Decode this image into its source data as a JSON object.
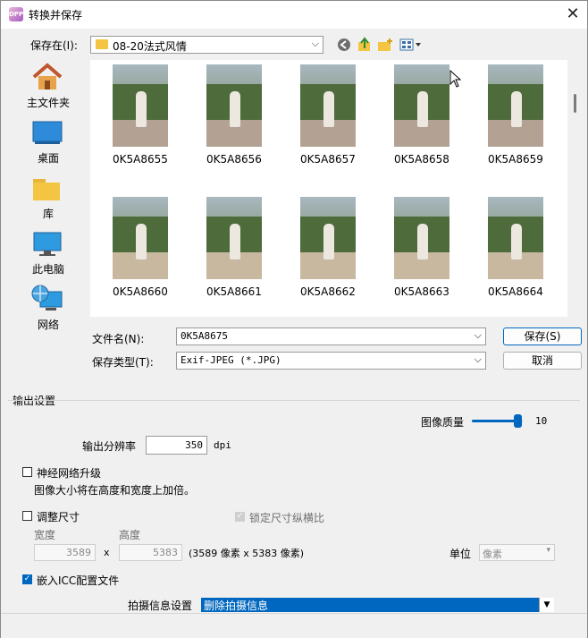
{
  "window": {
    "title": "转换并保存",
    "app_icon": "DPP",
    "close": "✕"
  },
  "save_in": {
    "label": "保存在(I):",
    "folder": "08-20法式风情"
  },
  "toolbar_icons": [
    "back-icon",
    "up-folder-icon",
    "new-folder-icon",
    "view-menu-icon"
  ],
  "places": [
    {
      "name": "home",
      "label": "主文件夹"
    },
    {
      "name": "desktop",
      "label": "桌面"
    },
    {
      "name": "library",
      "label": "库"
    },
    {
      "name": "this-pc",
      "label": "此电脑"
    },
    {
      "name": "network",
      "label": "网络"
    }
  ],
  "files": {
    "row1": [
      "0K5A8655",
      "0K5A8656",
      "0K5A8657",
      "0K5A8658",
      "0K5A8659"
    ],
    "row2": [
      "0K5A8660",
      "0K5A8661",
      "0K5A8662",
      "0K5A8663",
      "0K5A8664"
    ]
  },
  "filename": {
    "label": "文件名(N):",
    "value": "0K5A8675"
  },
  "filetype": {
    "label": "保存类型(T):",
    "value": "Exif-JPEG (*.JPG)"
  },
  "buttons": {
    "save": "保存(S)",
    "cancel": "取消"
  },
  "output": {
    "section_label": "输出设置",
    "quality_label": "图像质量",
    "quality_value": "10",
    "quality_fraction": 0.9,
    "resolution_label": "输出分辨率",
    "resolution_value": "350",
    "resolution_unit": "dpi",
    "upscale_label": "神经网络升级",
    "upscale_checked": false,
    "upscale_desc": "图像大小将在高度和宽度上加倍。",
    "resize_label": "调整尺寸",
    "resize_checked": false,
    "lock_ratio_label": "锁定尺寸纵横比",
    "lock_ratio_checked": true,
    "width_label": "宽度",
    "height_label": "高度",
    "width_value": "3589",
    "times": "x",
    "height_value": "5383",
    "size_note": "(3589 像素 x 5383 像素)",
    "unit_label": "单位",
    "unit_value": "像素",
    "icc_label": "嵌入ICC配置文件",
    "icc_checked": true,
    "shooting_label": "拍摄信息设置",
    "shooting_value": "删除拍摄信息"
  },
  "colors": {
    "accent": "#0067c0",
    "folder": "#f4c542",
    "window_bg": "#f0f0f0"
  }
}
